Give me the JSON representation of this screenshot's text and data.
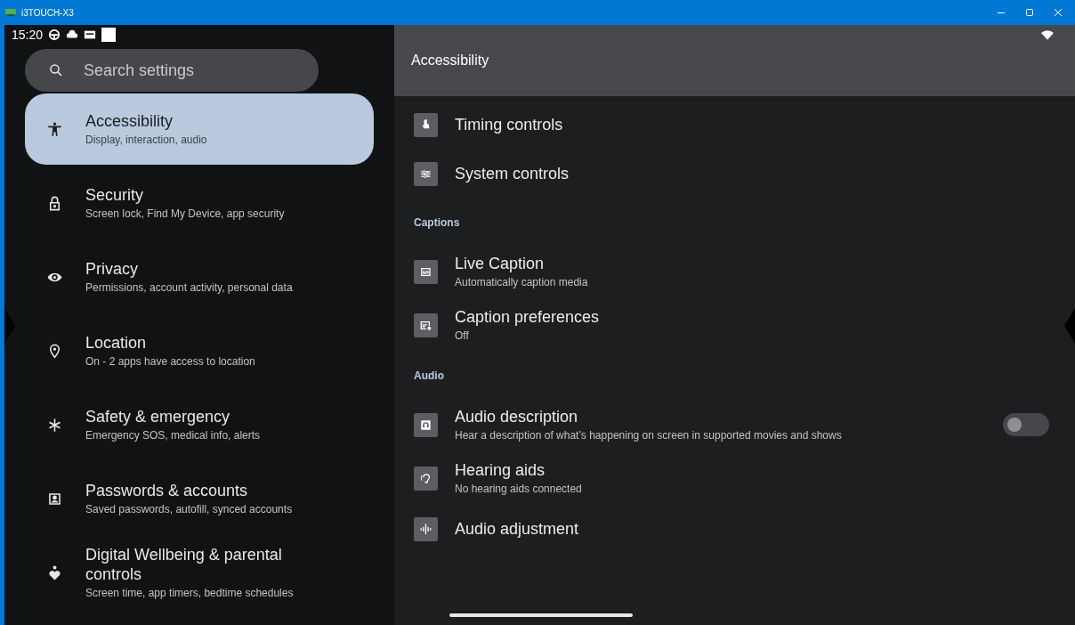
{
  "window": {
    "title": "i3TOUCH-X3"
  },
  "status_bar": {
    "time": "15:20"
  },
  "search": {
    "placeholder": "Search settings"
  },
  "sidebar": {
    "items": [
      {
        "title": "Accessibility",
        "subtitle": "Display, interaction, audio",
        "selected": true
      },
      {
        "title": "Security",
        "subtitle": "Screen lock, Find My Device, app security",
        "selected": false
      },
      {
        "title": "Privacy",
        "subtitle": "Permissions, account activity, personal data",
        "selected": false
      },
      {
        "title": "Location",
        "subtitle": "On - 2 apps have access to location",
        "selected": false
      },
      {
        "title": "Safety & emergency",
        "subtitle": "Emergency SOS, medical info, alerts",
        "selected": false
      },
      {
        "title": "Passwords & accounts",
        "subtitle": "Saved passwords, autofill, synced accounts",
        "selected": false
      },
      {
        "title": "Digital Wellbeing & parental controls",
        "subtitle": "Screen time, app timers, bedtime schedules",
        "selected": false
      }
    ]
  },
  "page": {
    "title": "Accessibility",
    "rows": [
      {
        "kind": "item",
        "title": "Timing controls"
      },
      {
        "kind": "item",
        "title": "System controls"
      },
      {
        "kind": "header",
        "title": "Captions"
      },
      {
        "kind": "item",
        "title": "Live Caption",
        "subtitle": "Automatically caption media"
      },
      {
        "kind": "item",
        "title": "Caption preferences",
        "subtitle": "Off"
      },
      {
        "kind": "header",
        "title": "Audio"
      },
      {
        "kind": "toggle",
        "title": "Audio description",
        "subtitle": "Hear a description of what’s happening on screen in supported movies and shows",
        "on": false
      },
      {
        "kind": "item",
        "title": "Hearing aids",
        "subtitle": "No hearing aids connected"
      },
      {
        "kind": "item",
        "title": "Audio adjustment"
      }
    ]
  }
}
